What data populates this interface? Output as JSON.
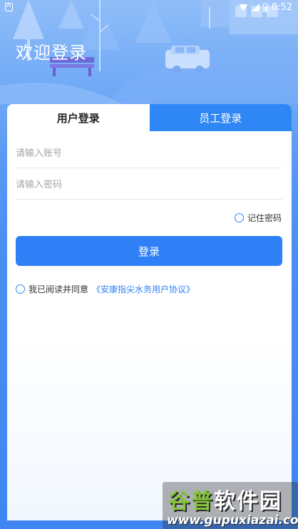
{
  "status_bar": {
    "time": "8:52"
  },
  "header": {
    "welcome": "欢迎登录"
  },
  "tabs": [
    {
      "label": "用户登录",
      "active": true
    },
    {
      "label": "员工登录",
      "active": false
    }
  ],
  "form": {
    "account_placeholder": "请输入账号",
    "password_placeholder": "请输入密码",
    "remember_label": "记住密码",
    "login_label": "登录",
    "agree_text": "我已阅读并同意",
    "agreement_link": "《安康指尖水务用户协议》"
  },
  "watermark": {
    "title_part1": "谷普",
    "title_part2": "软件园",
    "url": "www.gupuxiazai.com"
  },
  "colors": {
    "primary": "#2f80f6",
    "tab_inactive_bg": "#2f86f5",
    "hero_top": "#8fbdf8",
    "hero_bottom": "#3f86f1"
  }
}
